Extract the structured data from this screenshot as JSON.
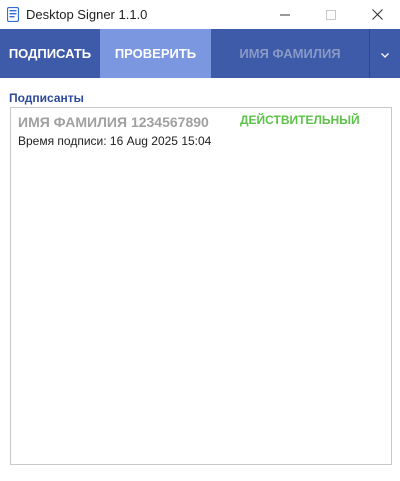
{
  "window": {
    "title": "Desktop Signer 1.1.0"
  },
  "tabs": [
    {
      "label": "ПОДПИСАТЬ",
      "active": false
    },
    {
      "label": "ПРОВЕРИТЬ",
      "active": true
    },
    {
      "label": "ИМЯ ФАМИЛИЯ",
      "active": false
    }
  ],
  "signers": {
    "label": "Подписанты",
    "items": [
      {
        "name": "ИМЯ ФАМИЛИЯ 1234567890",
        "status": "ДЕЙСТВИТЕЛЬНЫЙ",
        "time_label": "Время подписи: 16 Aug 2025 15:04"
      }
    ]
  },
  "colors": {
    "accent": "#3d5ba9",
    "active_tab": "#7b97e0",
    "status_valid": "#5cc24a",
    "section_label": "#2d4a9a"
  },
  "icons": {
    "app": "document-icon",
    "minimize": "minimize-icon",
    "maximize": "maximize-icon",
    "close": "close-icon",
    "dropdown": "chevron-down-icon"
  }
}
